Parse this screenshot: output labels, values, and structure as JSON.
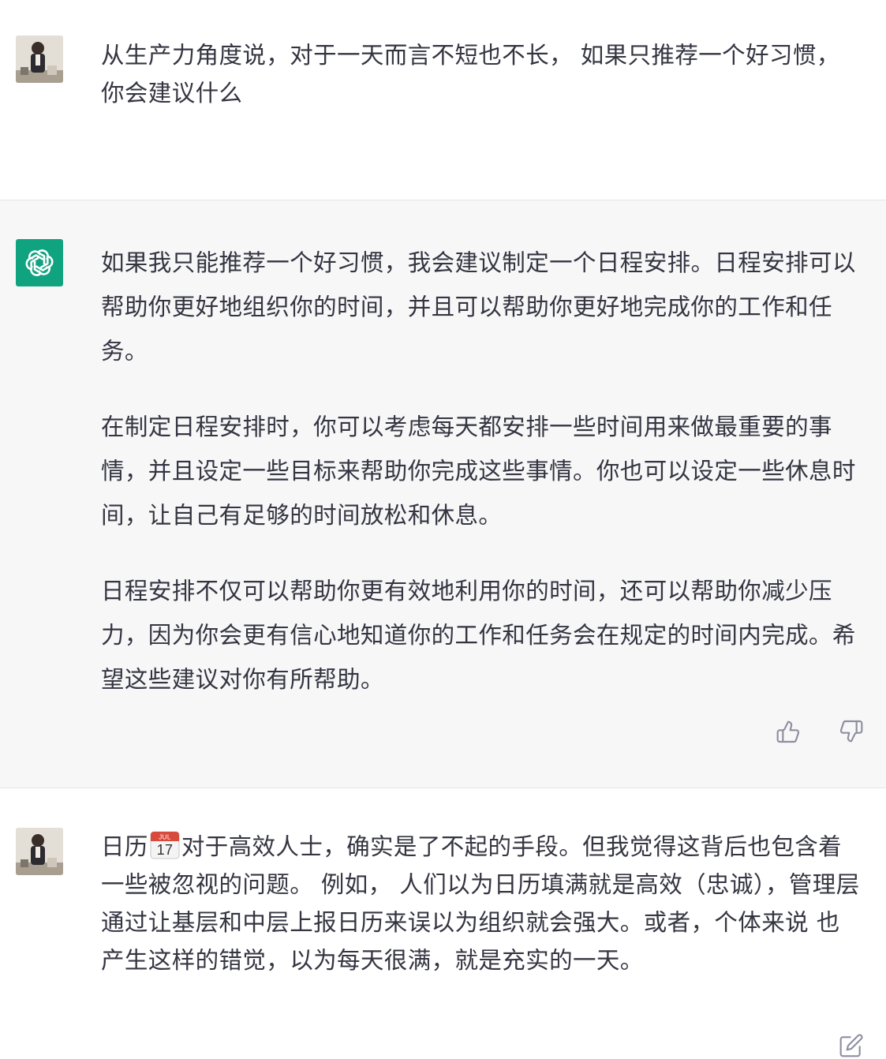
{
  "messages": [
    {
      "role": "user",
      "text": "从生产力角度说，对于一天而言不短也不长， 如果只推荐一个好习惯，你会建议什么"
    },
    {
      "role": "assistant",
      "paragraphs": [
        "如果我只能推荐一个好习惯，我会建议制定一个日程安排。日程安排可以帮助你更好地组织你的时间，并且可以帮助你更好地完成你的工作和任务。",
        "在制定日程安排时，你可以考虑每天都安排一些时间用来做最重要的事情，并且设定一些目标来帮助你完成这些事情。你也可以设定一些休息时间，让自己有足够的时间放松和休息。",
        "日程安排不仅可以帮助你更有效地利用你的时间，还可以帮助你减少压力，因为你会更有信心地知道你的工作和任务会在规定的时间内完成。希望这些建议对你有所帮助。"
      ],
      "actions": [
        "thumbs-up-icon",
        "thumbs-down-icon"
      ]
    },
    {
      "role": "user",
      "text_before_emoji": "日历",
      "emoji": {
        "icon": "calendar-icon",
        "month": "JUL",
        "day": "17"
      },
      "text_after_emoji": "对于高效人士，确实是了不起的手段。但我觉得这背后也包含着一些被忽视的问题。 例如， 人们以为日历填满就是高效（忠诚），管理层通过让基层和中层上报日历来误以为组织就会强大。或者，个体来说 也产生这样的错觉，以为每天很满，就是充实的一天。",
      "actions": [
        "edit-icon"
      ]
    }
  ],
  "colors": {
    "bot_avatar_bg": "#10a37f",
    "assistant_bg": "#f7f7f8",
    "text": "#343541",
    "icon": "#8e8ea0"
  }
}
